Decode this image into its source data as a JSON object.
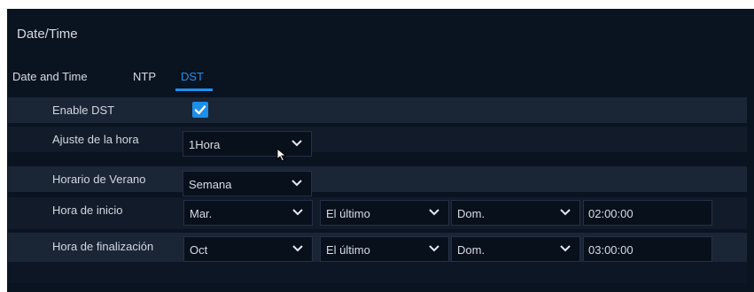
{
  "window": {
    "title": "Date/Time"
  },
  "tabs": [
    {
      "label": "Date and Time"
    },
    {
      "label": "NTP"
    },
    {
      "label": "DST"
    }
  ],
  "active_tab": "DST",
  "enable_dst": {
    "label": "Enable DST",
    "checked": true
  },
  "ajuste": {
    "label": "Ajuste de la hora",
    "value": "1Hora"
  },
  "horario": {
    "label": "Horario de Verano",
    "value": "Semana"
  },
  "inicio": {
    "label": "Hora de inicio",
    "month": "Mar.",
    "week": "El último",
    "day": "Dom.",
    "time": "02:00:00"
  },
  "fin": {
    "label": "Hora de finalización",
    "month": "Oct",
    "week": "El último",
    "day": "Dom.",
    "time": "03:00:00"
  },
  "colors": {
    "accent": "#1f8ff0",
    "panel": "#0a1320",
    "row_even": "#1a2536",
    "row_odd": "#121b29"
  },
  "icons": [
    "check-icon",
    "chevron-down-icon",
    "mouse-cursor-icon"
  ]
}
